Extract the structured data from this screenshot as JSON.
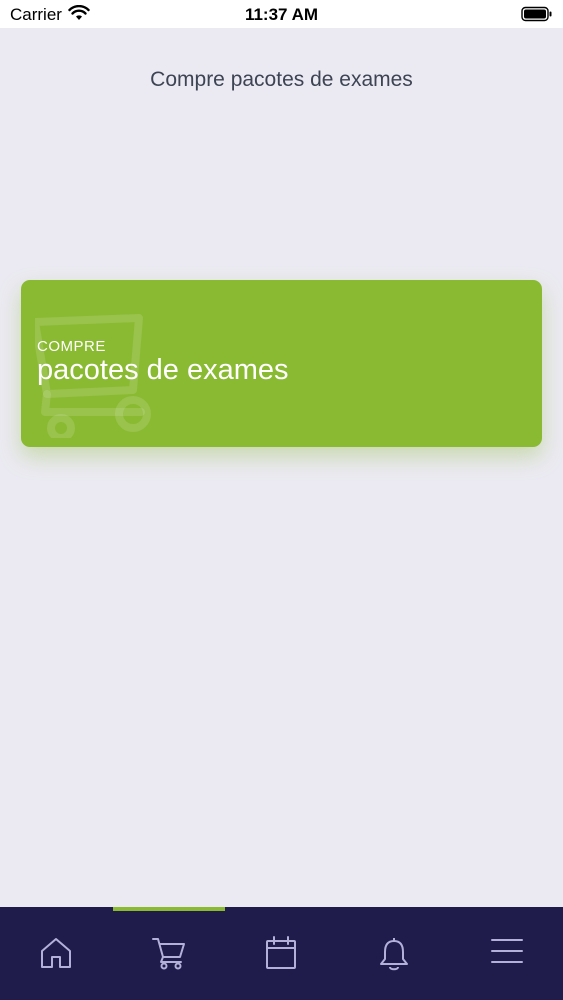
{
  "status_bar": {
    "carrier": "Carrier",
    "time": "11:37 AM"
  },
  "header": {
    "title": "Compre pacotes de exames"
  },
  "card": {
    "kicker": "COMPRE",
    "title": "pacotes de exames",
    "icon": "shopping-cart-icon"
  },
  "colors": {
    "accent": "#8aba32",
    "nav_background": "#1f1b4b",
    "page_background": "#ebeaf2",
    "icon_tint": "#b3b0da"
  },
  "tab_bar": {
    "active_index": 1,
    "items": [
      {
        "icon": "home-icon"
      },
      {
        "icon": "cart-icon"
      },
      {
        "icon": "calendar-icon"
      },
      {
        "icon": "bell-icon"
      },
      {
        "icon": "menu-icon"
      }
    ]
  }
}
